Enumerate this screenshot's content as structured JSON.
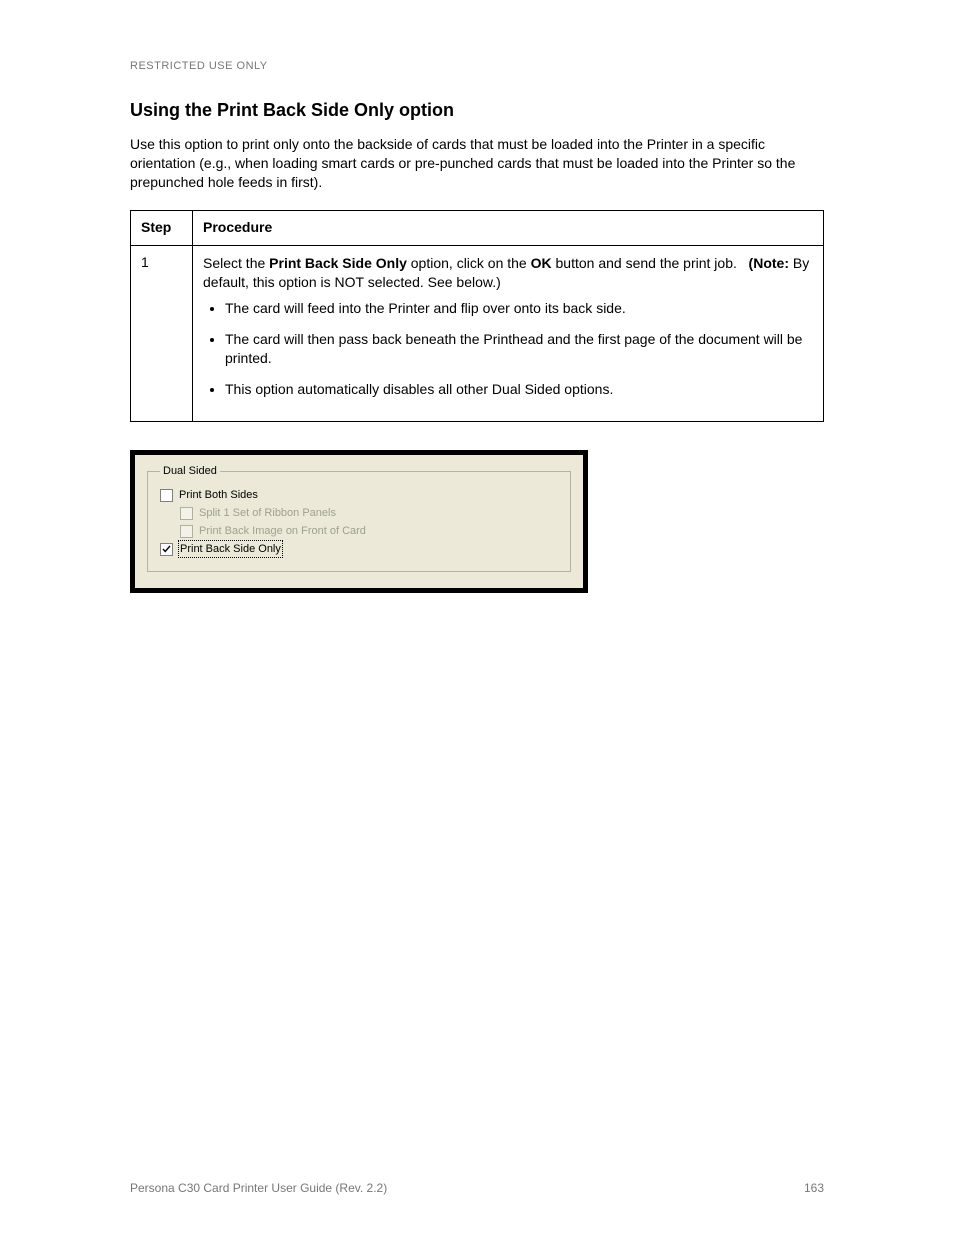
{
  "doc": {
    "restricted_header": "RESTRICTED USE ONLY",
    "heading": "Using the Print Back Side Only option",
    "intro": "Use this option to print only onto the backside of cards that must be loaded into the Printer in a specific orientation (e.g., when loading smart cards or pre-punched cards that must be loaded into the Printer so the prepunched hole feeds in first).",
    "table": {
      "head_step": "Step",
      "head_proc": "Procedure",
      "row1_step": "1",
      "row1_lead_a": "Select the ",
      "row1_lead_b": "Print Back Side Only",
      "row1_lead_c": " option, click on the ",
      "row1_lead_d": "OK",
      "row1_lead_e": " button and send the print job.",
      "row1_note_label": "(Note: ",
      "row1_note_text": "By default, this option is NOT selected.  See below.)",
      "row1_li1": "The card will feed into the Printer and flip over onto its back side.",
      "row1_li2": "The card will then pass back beneath the Printhead and the first page of the document will be printed.",
      "row1_li3": "This option automatically disables all other Dual Sided options."
    },
    "dialog": {
      "group_title": "Dual Sided",
      "print_both_sides": "Print Both Sides",
      "split_panels": "Split 1 Set of Ribbon Panels",
      "print_back_front": "Print Back Image on Front of Card",
      "print_back_only": "Print Back Side Only"
    },
    "footer": {
      "left": "Persona C30 Card Printer User Guide (Rev. 2.2)",
      "right": "163"
    }
  }
}
